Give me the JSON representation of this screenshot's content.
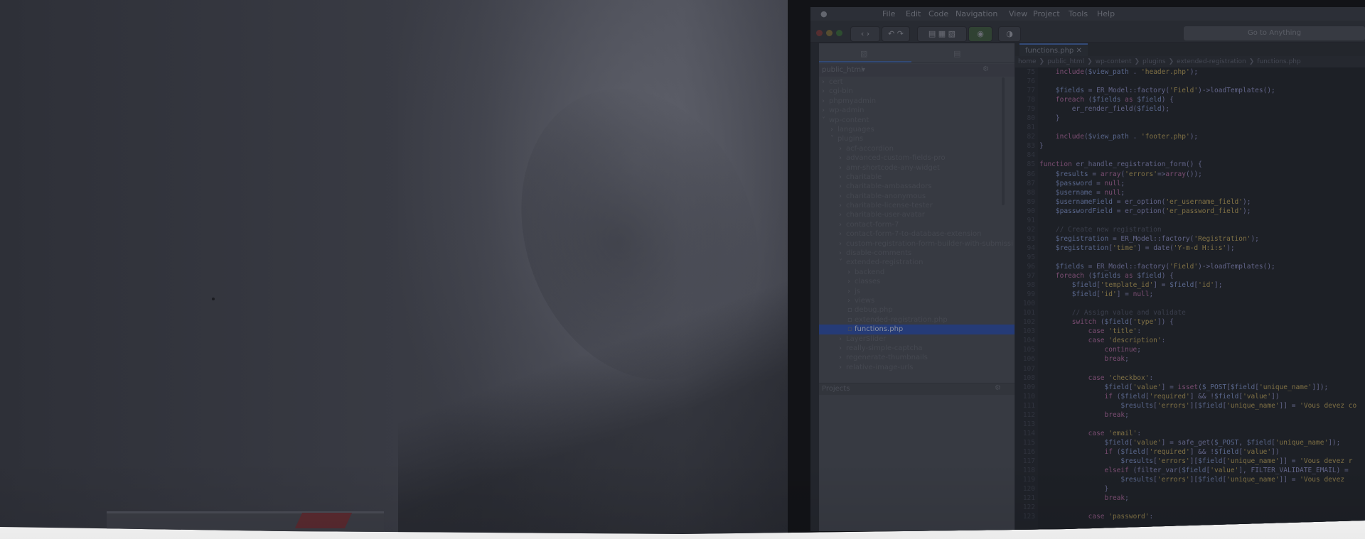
{
  "menubar": {
    "items": [
      "File",
      "Edit",
      "Code",
      "Navigation",
      "View",
      "Project",
      "Tools",
      "Help"
    ]
  },
  "toolbar": {
    "goto_placeholder": "Go to Anything"
  },
  "sidebar": {
    "root_label": "public_html",
    "projects_label": "Projects",
    "tree": [
      {
        "label": "cert",
        "depth": 0,
        "arrow": ">"
      },
      {
        "label": "cgi-bin",
        "depth": 0,
        "arrow": ">"
      },
      {
        "label": "phpmyadmin",
        "depth": 0,
        "arrow": ">"
      },
      {
        "label": "wp-admin",
        "depth": 0,
        "arrow": ">"
      },
      {
        "label": "wp-content",
        "depth": 0,
        "arrow": "v"
      },
      {
        "label": "languages",
        "depth": 1,
        "arrow": ">"
      },
      {
        "label": "plugins",
        "depth": 1,
        "arrow": "v"
      },
      {
        "label": "acf-accordion",
        "depth": 2,
        "arrow": ">"
      },
      {
        "label": "advanced-custom-fields-pro",
        "depth": 2,
        "arrow": ">"
      },
      {
        "label": "amr-shortcode-any-widget",
        "depth": 2,
        "arrow": ">"
      },
      {
        "label": "charitable",
        "depth": 2,
        "arrow": ">"
      },
      {
        "label": "charitable-ambassadors",
        "depth": 2,
        "arrow": ">"
      },
      {
        "label": "charitable-anonymous",
        "depth": 2,
        "arrow": ">"
      },
      {
        "label": "charitable-license-tester",
        "depth": 2,
        "arrow": ">"
      },
      {
        "label": "charitable-user-avatar",
        "depth": 2,
        "arrow": ">"
      },
      {
        "label": "contact-form-7",
        "depth": 2,
        "arrow": ">"
      },
      {
        "label": "contact-form-7-to-database-extension",
        "depth": 2,
        "arrow": ">"
      },
      {
        "label": "custom-registration-form-builder-with-submissi",
        "depth": 2,
        "arrow": ">"
      },
      {
        "label": "disable-comments",
        "depth": 2,
        "arrow": ">"
      },
      {
        "label": "extended-registration",
        "depth": 2,
        "arrow": "v"
      },
      {
        "label": "backend",
        "depth": 3,
        "arrow": ">"
      },
      {
        "label": "classes",
        "depth": 3,
        "arrow": ">"
      },
      {
        "label": "js",
        "depth": 3,
        "arrow": ">"
      },
      {
        "label": "views",
        "depth": 3,
        "arrow": ">"
      },
      {
        "label": "debug.php",
        "depth": 3,
        "arrow": ""
      },
      {
        "label": "extended-registration.php",
        "depth": 3,
        "arrow": ""
      },
      {
        "label": "functions.php",
        "depth": 3,
        "arrow": "",
        "selected": true
      },
      {
        "label": "LayerSlider",
        "depth": 2,
        "arrow": ">"
      },
      {
        "label": "really-simple-captcha",
        "depth": 2,
        "arrow": ">"
      },
      {
        "label": "regenerate-thumbnails",
        "depth": 2,
        "arrow": ">"
      },
      {
        "label": "relative-image-urls",
        "depth": 2,
        "arrow": ">"
      }
    ]
  },
  "editor": {
    "tab_label": "functions.php",
    "breadcrumb": [
      "home",
      "public_html",
      "wp-content",
      "plugins",
      "extended-registration",
      "functions.php"
    ],
    "lines": [
      {
        "n": "75",
        "t": "    include($view_path . 'header.php');"
      },
      {
        "n": "76",
        "t": ""
      },
      {
        "n": "77",
        "t": "    $fields = ER_Model::factory('Field')->loadTemplates();"
      },
      {
        "n": "78",
        "t": "    foreach ($fields as $field) {"
      },
      {
        "n": "79",
        "t": "        er_render_field($field);"
      },
      {
        "n": "80",
        "t": "    }"
      },
      {
        "n": "81",
        "t": ""
      },
      {
        "n": "82",
        "t": "    include($view_path . 'footer.php');"
      },
      {
        "n": "83",
        "t": "}"
      },
      {
        "n": "84",
        "t": ""
      },
      {
        "n": "85",
        "t": "function er_handle_registration_form() {"
      },
      {
        "n": "86",
        "t": "    $results = array('errors'=>array());"
      },
      {
        "n": "87",
        "t": "    $password = null;"
      },
      {
        "n": "88",
        "t": "    $username = null;"
      },
      {
        "n": "89",
        "t": "    $usernameField = er_option('er_username_field');"
      },
      {
        "n": "90",
        "t": "    $passwordField = er_option('er_password_field');"
      },
      {
        "n": "91",
        "t": ""
      },
      {
        "n": "92",
        "t": "    // Create new registration"
      },
      {
        "n": "93",
        "t": "    $registration = ER_Model::factory('Registration');"
      },
      {
        "n": "94",
        "t": "    $registration['time'] = date('Y-m-d H:i:s');"
      },
      {
        "n": "95",
        "t": ""
      },
      {
        "n": "96",
        "t": "    $fields = ER_Model::factory('Field')->loadTemplates();"
      },
      {
        "n": "97",
        "t": "    foreach ($fields as $field) {"
      },
      {
        "n": "98",
        "t": "        $field['template_id'] = $field['id'];"
      },
      {
        "n": "99",
        "t": "        $field['id'] = null;"
      },
      {
        "n": "100",
        "t": ""
      },
      {
        "n": "101",
        "t": "        // Assign value and validate"
      },
      {
        "n": "102",
        "t": "        switch ($field['type']) {"
      },
      {
        "n": "103",
        "t": "            case 'title':"
      },
      {
        "n": "104",
        "t": "            case 'description':"
      },
      {
        "n": "105",
        "t": "                continue;"
      },
      {
        "n": "106",
        "t": "                break;"
      },
      {
        "n": "107",
        "t": ""
      },
      {
        "n": "108",
        "t": "            case 'checkbox':"
      },
      {
        "n": "109",
        "t": "                $field['value'] = isset($_POST[$field['unique_name']]);"
      },
      {
        "n": "110",
        "t": "                if ($field['required'] && !$field['value'])"
      },
      {
        "n": "111",
        "t": "                    $results['errors'][$field['unique_name']] = 'Vous devez co"
      },
      {
        "n": "112",
        "t": "                break;"
      },
      {
        "n": "113",
        "t": ""
      },
      {
        "n": "114",
        "t": "            case 'email':"
      },
      {
        "n": "115",
        "t": "                $field['value'] = safe_get($_POST, $field['unique_name']);"
      },
      {
        "n": "116",
        "t": "                if ($field['required'] && !$field['value'])"
      },
      {
        "n": "117",
        "t": "                    $results['errors'][$field['unique_name']] = 'Vous devez r"
      },
      {
        "n": "118",
        "t": "                elseif (filter_var($field['value'], FILTER_VALIDATE_EMAIL) ="
      },
      {
        "n": "119",
        "t": "                    $results['errors'][$field['unique_name']] = 'Vous devez"
      },
      {
        "n": "120",
        "t": "                }"
      },
      {
        "n": "121",
        "t": "                break;"
      },
      {
        "n": "122",
        "t": ""
      },
      {
        "n": "123",
        "t": "            case 'password':"
      }
    ]
  }
}
